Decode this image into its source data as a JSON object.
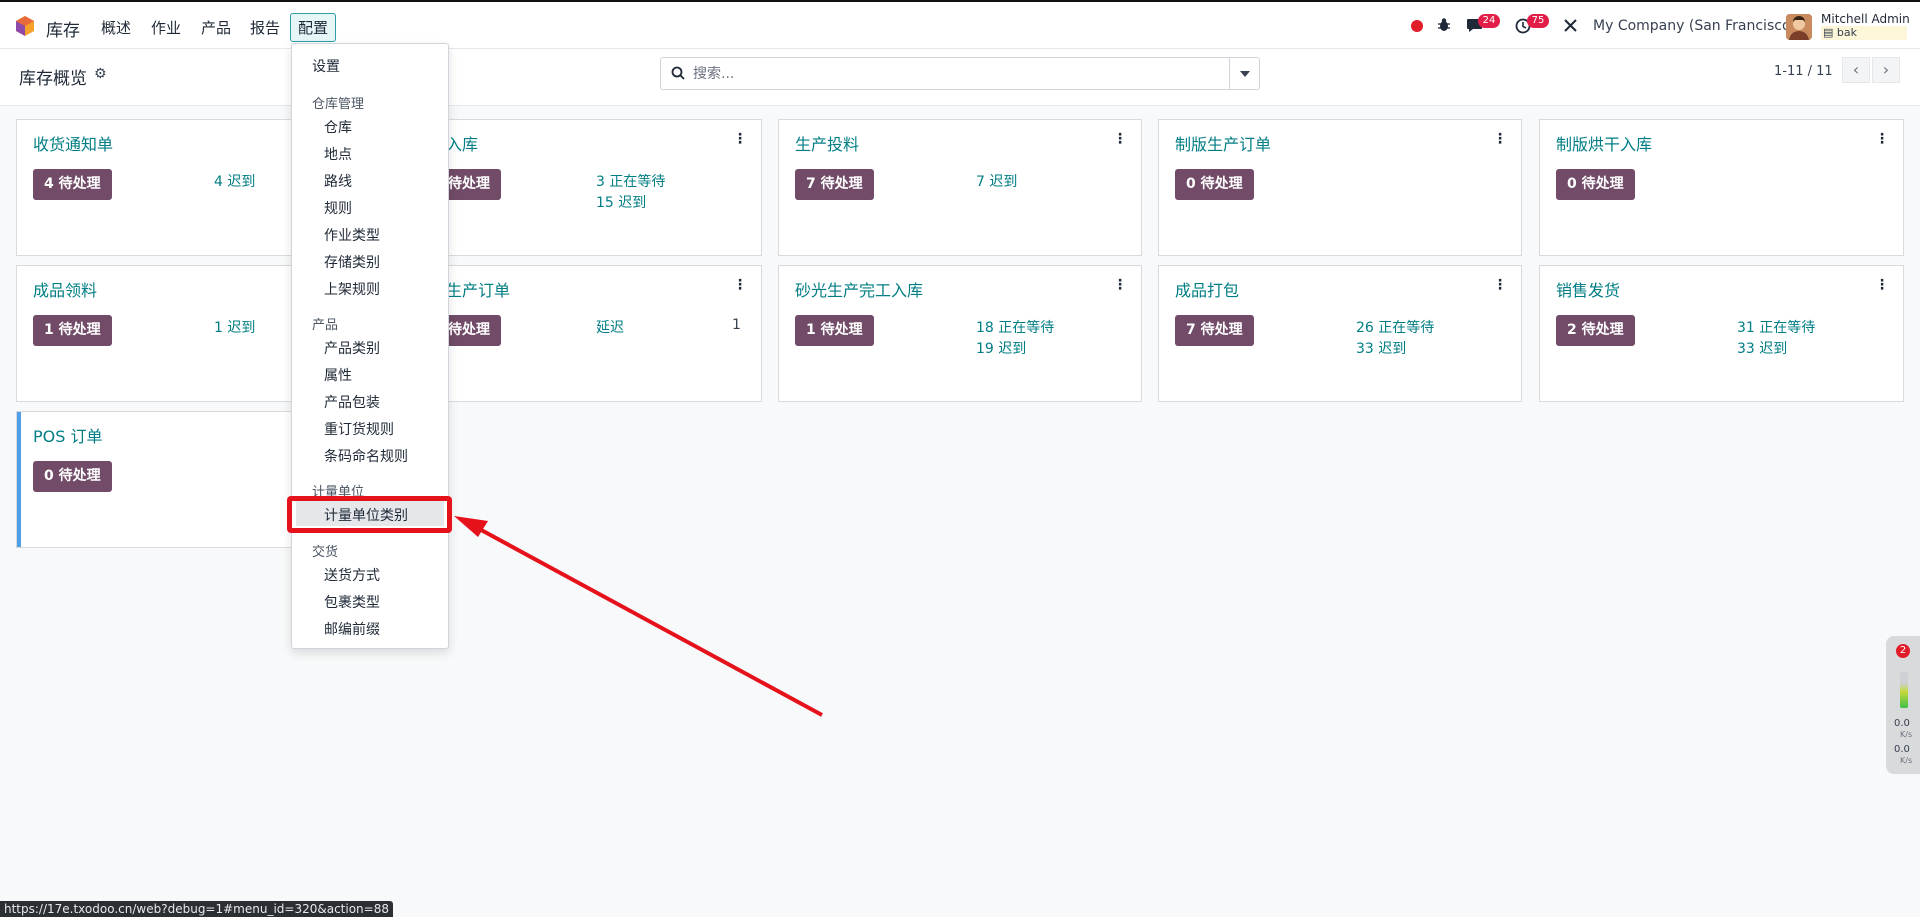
{
  "navbar": {
    "app_name": "库存",
    "menus": [
      "概述",
      "作业",
      "产品",
      "报告",
      "配置"
    ],
    "chat_count": "24",
    "activity_count": "75",
    "company": "My Company (San Francisco)",
    "user_name": "Mitchell Admin",
    "database": "bak"
  },
  "control": {
    "title": "库存概览",
    "search_placeholder": "搜索...",
    "pager": "1-11 / 11"
  },
  "cards": [
    {
      "title": "收货通知单",
      "todo": "4 待处理",
      "stats": [
        "4 迟到"
      ]
    },
    {
      "title": "入库",
      "todo": "待处理",
      "stats": [
        "3 正在等待",
        "15 迟到"
      ]
    },
    {
      "title": "生产投料",
      "todo": "7 待处理",
      "stats": [
        "7 迟到"
      ]
    },
    {
      "title": "制版生产订单",
      "todo": "0 待处理",
      "stats": []
    },
    {
      "title": "制版烘干入库",
      "todo": "0 待处理",
      "stats": []
    },
    {
      "title": "成品领料",
      "todo": "1 待处理",
      "stats": [
        "1 迟到"
      ]
    },
    {
      "title": "生产订单",
      "todo": "待处理",
      "stats": [
        "延迟"
      ],
      "extra": "1"
    },
    {
      "title": "砂光生产完工入库",
      "todo": "1 待处理",
      "stats": [
        "18 正在等待",
        "19 迟到"
      ]
    },
    {
      "title": "成品打包",
      "todo": "7 待处理",
      "stats": [
        "26 正在等待",
        "33 迟到"
      ]
    },
    {
      "title": "销售发货",
      "todo": "2 待处理",
      "stats": [
        "31 正在等待",
        "33 迟到"
      ]
    },
    {
      "title": "POS 订单",
      "todo": "0 待处理",
      "stats": []
    }
  ],
  "dropdown": {
    "settings": "设置",
    "sections": [
      {
        "header": "仓库管理",
        "items": [
          "仓库",
          "地点",
          "路线",
          "规则",
          "作业类型",
          "存储类别",
          "上架规则"
        ]
      },
      {
        "header": "产品",
        "items": [
          "产品类别",
          "属性",
          "产品包装",
          "重订货规则",
          "条码命名规则"
        ]
      },
      {
        "header": "计量单位",
        "items": [
          "计量单位类别"
        ]
      },
      {
        "header": "交货",
        "items": [
          "送货方式",
          "包裹类型",
          "邮编前缀"
        ]
      }
    ],
    "highlighted_item": "计量单位类别"
  },
  "widget": {
    "badge": "2",
    "upload": "0.0",
    "download": "0.0",
    "unit": "K/s"
  },
  "status_url": "https://17e.txodoo.cn/web?debug=1#menu_id=320&action=88",
  "colors": {
    "accent_teal": "#017e84",
    "todo_button": "#714b67",
    "annotation_red": "#e5121b"
  }
}
